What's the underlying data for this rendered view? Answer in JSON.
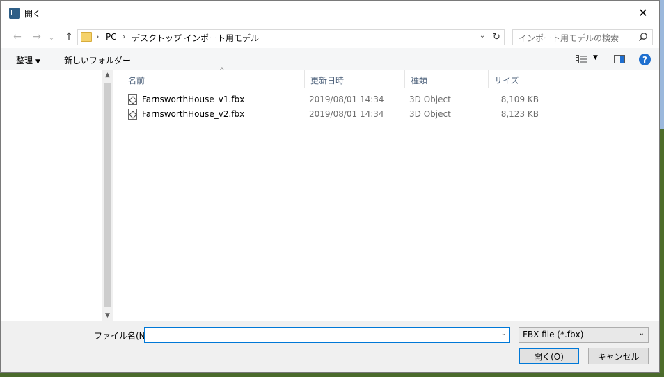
{
  "window": {
    "title": "開く",
    "close_glyph": "✕"
  },
  "nav": {
    "back_glyph": "←",
    "forward_glyph": "→",
    "recent_glyph": "⌄",
    "up_glyph": "↑",
    "breadcrumbs": [
      "PC",
      "デスクトップ",
      "インポート用モデル"
    ],
    "breadcrumb_sep": "›",
    "refresh_glyph": "↻",
    "dropdown_glyph": "⌄"
  },
  "search": {
    "placeholder": "インポート用モデルの検索"
  },
  "toolbar": {
    "organize_label": "整理",
    "organize_caret": "▼",
    "new_folder_label": "新しいフォルダー",
    "view_caret": "▼",
    "help_label": "?"
  },
  "columns": {
    "name": "名前",
    "date": "更新日時",
    "type": "種類",
    "size": "サイズ",
    "sort_glyph": "^"
  },
  "files": [
    {
      "name": "FarnsworthHouse_v1.fbx",
      "date": "2019/08/01 14:34",
      "type": "3D Object",
      "size": "8,109 KB"
    },
    {
      "name": "FarnsworthHouse_v2.fbx",
      "date": "2019/08/01 14:34",
      "type": "3D Object",
      "size": "8,123 KB"
    }
  ],
  "scroll": {
    "up_glyph": "▲",
    "down_glyph": "▼"
  },
  "bottom": {
    "filename_label": "ファイル名(N):",
    "filename_value": "",
    "filename_caret": "⌄",
    "filetype_value": "FBX file (*.fbx)",
    "filetype_caret": "⌄",
    "open_label": "開く(O)",
    "cancel_label": "キャンセル"
  },
  "colors": {
    "accent": "#0078d7",
    "help": "#1e6fcf",
    "folder": "#f5d26b"
  }
}
